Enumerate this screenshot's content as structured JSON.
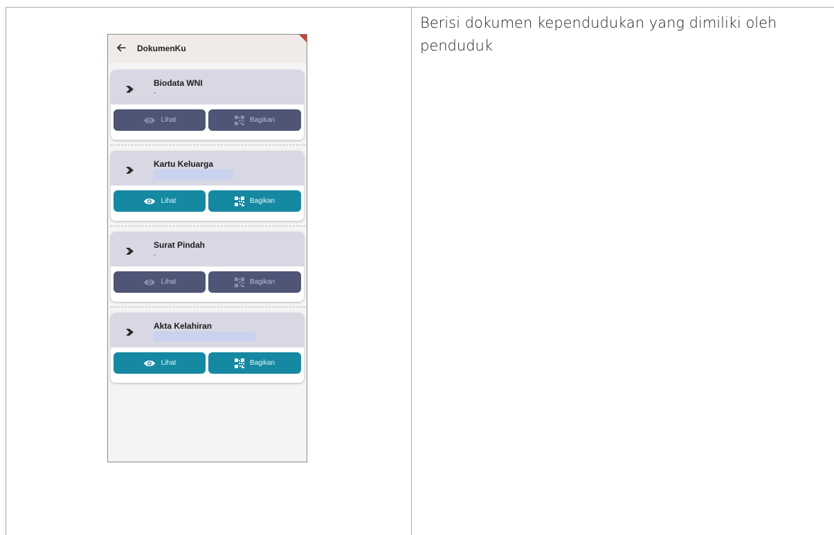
{
  "description": "Berisi dokumen kependudukan yang dimiliki oleh penduduk",
  "app": {
    "title": "DokumenKu"
  },
  "documents": [
    {
      "title": "Biodata WNI",
      "subtitle": "-",
      "view_label": "Lihat",
      "share_label": "Bagikan",
      "enabled": false
    },
    {
      "title": "Kartu Keluarga",
      "subtitle": "",
      "view_label": "Lihat",
      "share_label": "Bagikan",
      "enabled": true
    },
    {
      "title": "Surat Pindah",
      "subtitle": "-",
      "view_label": "Lihat",
      "share_label": "Bagikan",
      "enabled": false
    },
    {
      "title": "Akta Kelahiran",
      "subtitle": "",
      "view_label": "Lihat",
      "share_label": "Bagikan",
      "enabled": true
    }
  ],
  "colors": {
    "button_disabled": "#4e5576",
    "button_enabled": "#1689a2",
    "card_header": "#d8d8e4",
    "appbar": "#f0ebe8"
  },
  "icons": {
    "back": "arrow-left-icon",
    "chevron": "chevron-right-icon",
    "view": "eye-icon",
    "share": "qr-code-icon"
  }
}
